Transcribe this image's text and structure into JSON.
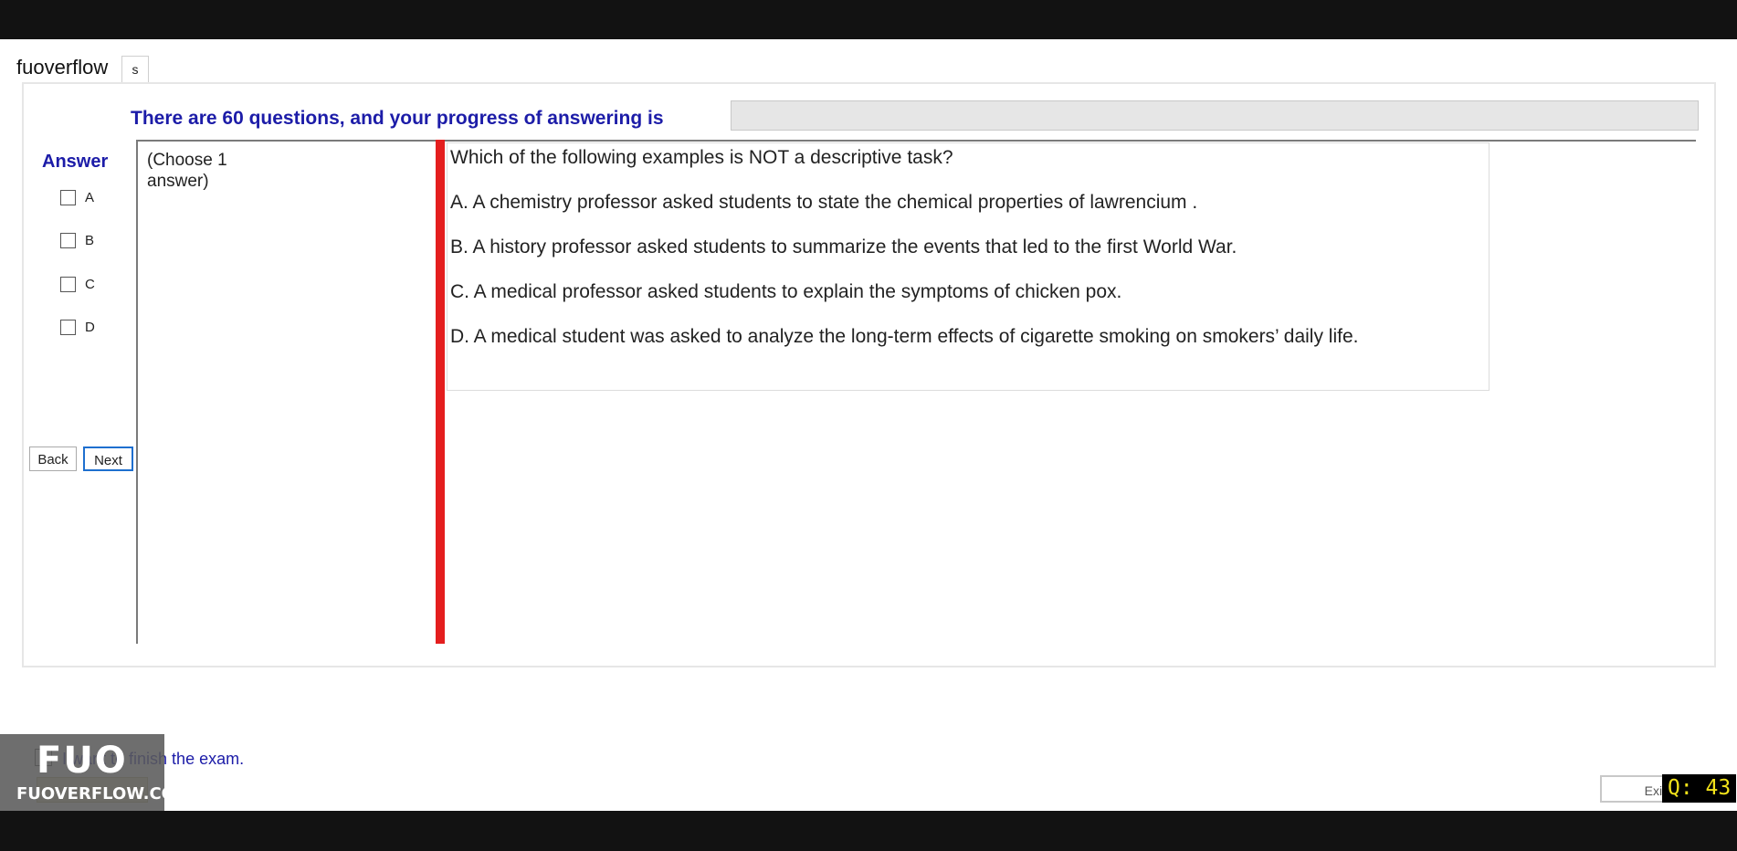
{
  "brand": "fuoverflow",
  "tab_label": "s",
  "progress_label": "There are 60 questions, and your progress of answering is",
  "answer_heading": "Answer",
  "answer_options": [
    "A",
    "B",
    "C",
    "D"
  ],
  "buttons": {
    "back": "Back",
    "next": "Next"
  },
  "choose_hint": "(Choose 1 answer)",
  "question": {
    "prompt": "Which of the following examples is NOT a descriptive task?",
    "options": [
      "A.  A chemistry professor asked students to state the chemical properties of lawrencium .",
      "B.  A history professor asked students to summarize the events that led to the first World War.",
      "C.  A medical professor asked students to explain the symptoms of chicken pox.",
      "D.  A medical student was asked to analyze the long-term effects of cigarette smoking on smokers’ daily life."
    ]
  },
  "finish_label": "I want to finish the exam.",
  "watermark": {
    "mark": "FUO",
    "text": "FUOVERFLOW.COM"
  },
  "exit_label": "Exit",
  "question_counter": "Q: 43"
}
